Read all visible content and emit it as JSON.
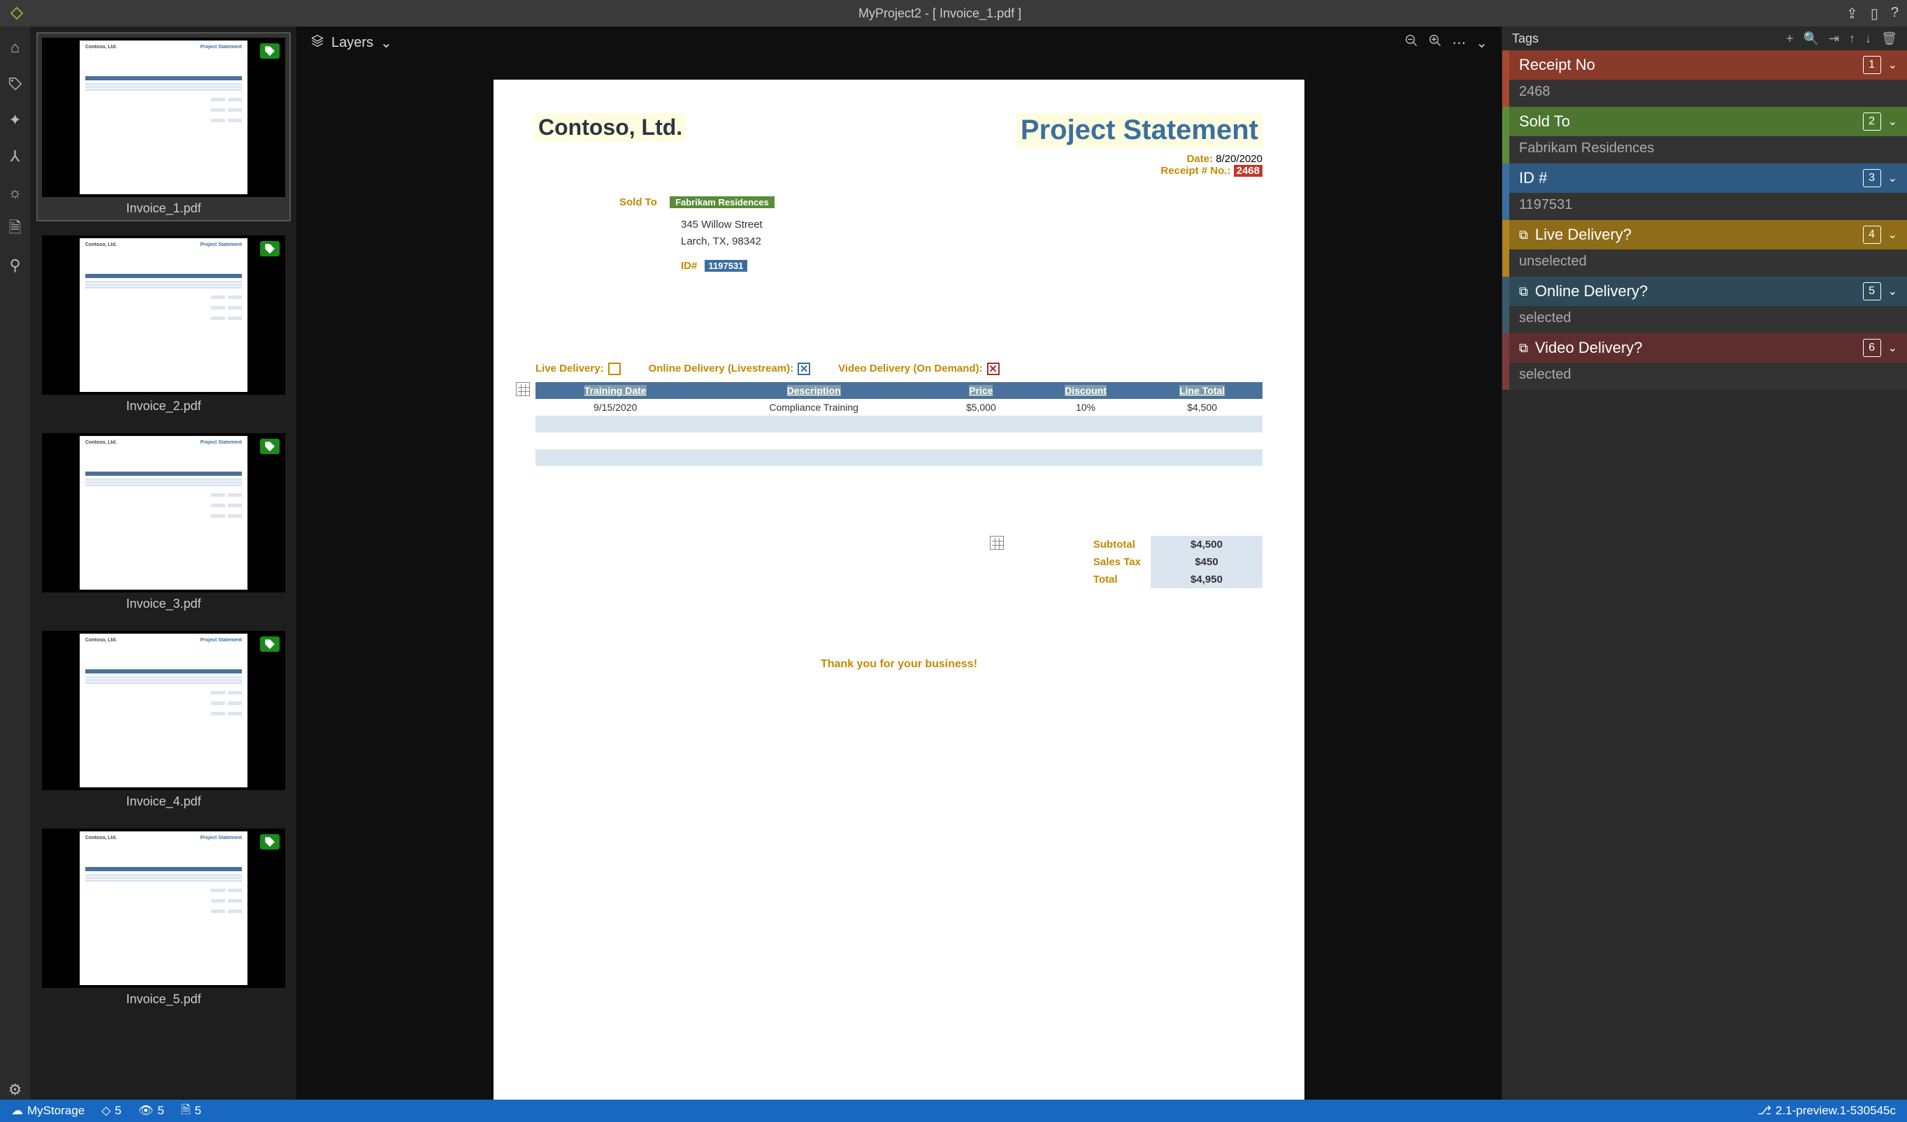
{
  "titlebar": {
    "title": "MyProject2 - [ Invoice_1.pdf ]"
  },
  "thumbnails": [
    {
      "name": "Invoice_1.pdf",
      "selected": true
    },
    {
      "name": "Invoice_2.pdf",
      "selected": false
    },
    {
      "name": "Invoice_3.pdf",
      "selected": false
    },
    {
      "name": "Invoice_4.pdf",
      "selected": false
    },
    {
      "name": "Invoice_5.pdf",
      "selected": false
    }
  ],
  "toolbar": {
    "layers_label": "Layers"
  },
  "document": {
    "company": "Contoso, Ltd.",
    "statement_title": "Project Statement",
    "date_label": "Date:",
    "date_value": "8/20/2020",
    "receipt_label": "Receipt # No.:",
    "receipt_value": "2468",
    "sold_to_label": "Sold To",
    "sold_to_name": "Fabrikam Residences",
    "addr1": "345 Willow Street",
    "addr2": "Larch, TX, 98342",
    "id_label": "ID#",
    "id_value": "1197531",
    "live_label": "Live Delivery:",
    "online_label": "Online Delivery (Livestream):",
    "video_label": "Video Delivery (On Demand):",
    "columns": {
      "c1": "Training Date",
      "c2": "Description",
      "c3": "Price",
      "c4": "Discount",
      "c5": "Line Total"
    },
    "row1": {
      "c1": "9/15/2020",
      "c2": "Compliance Training",
      "c3": "$5,000",
      "c4": "10%",
      "c5": "$4,500"
    },
    "totals": {
      "subtotal_label": "Subtotal",
      "subtotal_val": "$4,500",
      "tax_label": "Sales Tax",
      "tax_val": "$450",
      "total_label": "Total",
      "total_val": "$4,950"
    },
    "thanks": "Thank you for your business!"
  },
  "tags_header": {
    "title": "Tags"
  },
  "tags": {
    "receipt": {
      "name": "Receipt No",
      "num": "1",
      "value": "2468"
    },
    "sold": {
      "name": "Sold To",
      "num": "2",
      "value": "Fabrikam Residences"
    },
    "id": {
      "name": "ID #",
      "num": "3",
      "value": "1197531"
    },
    "live": {
      "name": "Live Delivery?",
      "num": "4",
      "value": "unselected"
    },
    "online": {
      "name": "Online Delivery?",
      "num": "5",
      "value": "selected"
    },
    "video": {
      "name": "Video Delivery?",
      "num": "6",
      "value": "selected"
    }
  },
  "statusbar": {
    "storage": "MyStorage",
    "count1": "5",
    "count2": "5",
    "count3": "5",
    "version": "2.1-preview.1-530545c"
  }
}
